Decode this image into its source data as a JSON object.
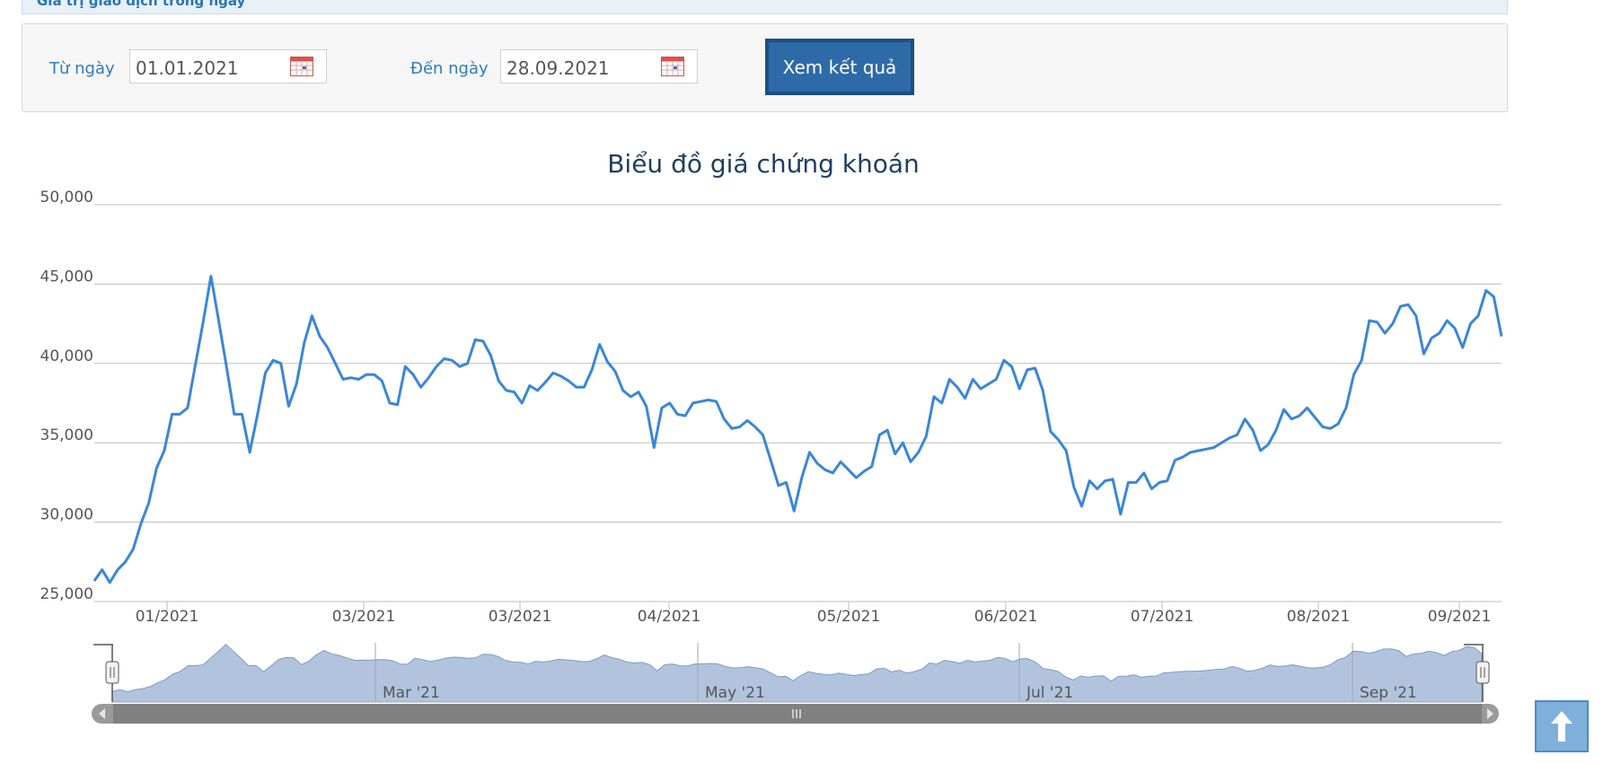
{
  "top_strip": {
    "label": "Giá trị giao dịch trong ngày"
  },
  "filter": {
    "from_label": "Từ ngày",
    "from_value": "01.01.2021",
    "to_label": "Đến ngày",
    "to_value": "28.09.2021",
    "submit_label": "Xem kết quả",
    "calendar_icon": "calendar-icon"
  },
  "colors": {
    "line": "#3a86d8",
    "grid": "#bdbdbd",
    "title": "#1f3f63",
    "label": "#555555",
    "navigator_fill": "#b2c4dd",
    "scrollbar": "#808080"
  },
  "chart_data": {
    "type": "line",
    "title": "Biểu đồ giá chứng khoán",
    "ylim": [
      25000,
      50000
    ],
    "yticks": [
      "25,000",
      "30,000",
      "35,000",
      "40,000",
      "45,000",
      "50,000"
    ],
    "xticks": [
      "01/2021",
      "03/2021",
      "03/2021",
      "04/2021",
      "05/2021",
      "06/2021",
      "07/2021",
      "08/2021",
      "09/2021"
    ],
    "navigator_labels": [
      "Mar '21",
      "May '21",
      "Jul '21",
      "Sep '21"
    ],
    "grid": true,
    "legend": "none",
    "series": [
      {
        "values": [
          26300,
          27000,
          26200,
          27000,
          27500,
          28300,
          29900,
          31200,
          33400,
          34500,
          36800,
          36800,
          37200,
          39900,
          42600,
          45500,
          42700,
          39800,
          36800,
          36800,
          34400,
          36800,
          39400,
          40200,
          40000,
          37300,
          38700,
          41300,
          43000,
          41700,
          41000,
          40000,
          39000,
          39100,
          39000,
          39300,
          39300,
          38900,
          37500,
          37400,
          39800,
          39300,
          38500,
          39100,
          39800,
          40300,
          40200,
          39800,
          40000,
          41500,
          41400,
          40500,
          38900,
          38300,
          38200,
          37500,
          38600,
          38300,
          38800,
          39400,
          39200,
          38900,
          38500,
          38500,
          39600,
          41200,
          40100,
          39500,
          38300,
          37900,
          38200,
          37300,
          34700,
          37200,
          37500,
          36800,
          36700,
          37500,
          37600,
          37700,
          37600,
          36500,
          35900,
          36000,
          36400,
          36000,
          35500,
          33900,
          32300,
          32500,
          30700,
          32800,
          34400,
          33700,
          33300,
          33100,
          33800,
          33300,
          32800,
          33200,
          33500,
          35500,
          35800,
          34300,
          35000,
          33800,
          34400,
          35400,
          37900,
          37500,
          39000,
          38500,
          37800,
          39000,
          38400,
          38700,
          39000,
          40200,
          39800,
          38400,
          39600,
          39700,
          38300,
          35700,
          35200,
          34500,
          32200,
          31000,
          32600,
          32100,
          32600,
          32700,
          30500,
          32500,
          32500,
          33100,
          32100,
          32500,
          32600,
          33900,
          34100,
          34400,
          34500,
          34600,
          34700,
          35000,
          35300,
          35500,
          36500,
          35800,
          34500,
          34900,
          35800,
          37100,
          36500,
          36700,
          37200,
          36600,
          36000,
          35900,
          36200,
          37200,
          39300,
          40200,
          42700,
          42600,
          41900,
          42500,
          43600,
          43700,
          43000,
          40600,
          41600,
          41900,
          42700,
          42200,
          41000,
          42500,
          43000,
          44600,
          44200,
          41700
        ]
      }
    ]
  }
}
